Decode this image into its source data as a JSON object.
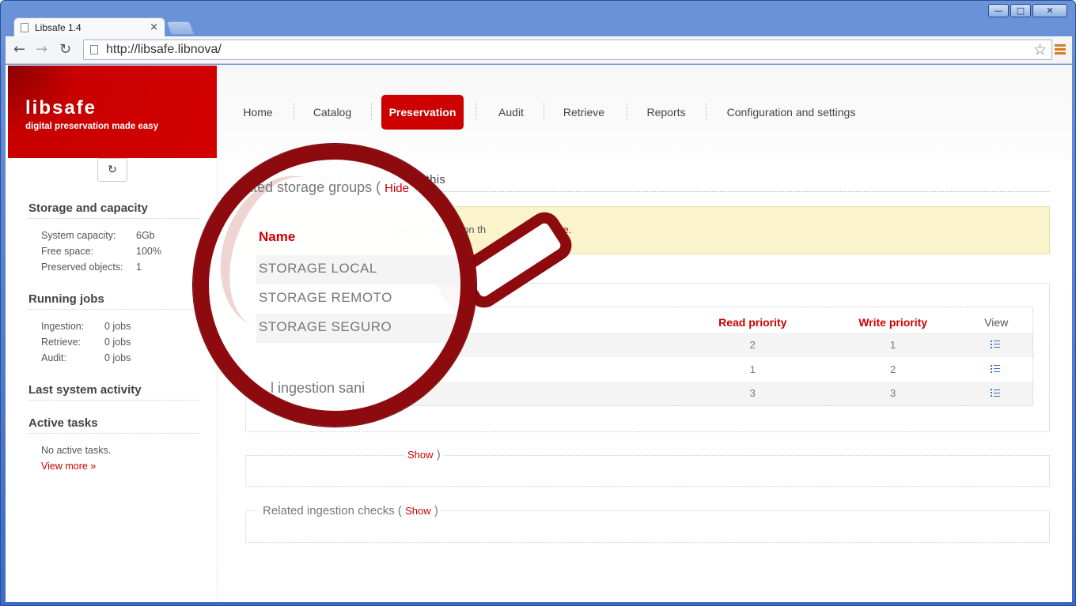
{
  "browser": {
    "tab_title": "Libsafe 1.4",
    "tab_close": "×",
    "url": "http://libsafe.libnova/",
    "window_buttons": [
      "▭",
      "◻",
      "✕"
    ]
  },
  "brand": {
    "name": "libsafe",
    "tagline": "digital preservation made easy"
  },
  "nav": [
    {
      "label": "Home"
    },
    {
      "label": "Catalog"
    },
    {
      "label": "Preservation",
      "active": true
    },
    {
      "label": "Audit"
    },
    {
      "label": "Retrieve"
    },
    {
      "label": "Reports"
    },
    {
      "label": "Configuration and settings"
    }
  ],
  "sidebar": {
    "storage_title": "Storage and capacity",
    "storage": [
      {
        "label": "System capacity:",
        "value": "6Gb"
      },
      {
        "label": "Free space:",
        "value": "100%"
      },
      {
        "label": "Preserved objects:",
        "value": "1"
      }
    ],
    "jobs_title": "Running jobs",
    "jobs": [
      {
        "label": "Ingestion:",
        "value": "0 jobs"
      },
      {
        "label": "Retrieve:",
        "value": "0 jobs"
      },
      {
        "label": "Audit:",
        "value": "0 jobs"
      }
    ],
    "activity_title": "Last system activity",
    "tasks_title": "Active tasks",
    "no_tasks": "No active tasks.",
    "view_more": "View more »"
  },
  "main": {
    "title": "New preservation plan based on this",
    "notice_prefix": "F",
    "notice_mid": "ion plan based on th",
    "notice_link": "ck here.",
    "storage_groups_legend": "elated storage groups (",
    "storage_groups_toggle": "Hide",
    "table": {
      "headers": [
        "Name",
        "Read priority",
        "Write priority",
        "View"
      ],
      "rows": [
        {
          "name": "STORAGE LOCAL",
          "read": "2",
          "write": "1"
        },
        {
          "name": "STORAGE REMOTO",
          "read": "1",
          "write": "2"
        },
        {
          "name": "STORAGE SEGURO",
          "read": "3",
          "write": "3"
        }
      ]
    },
    "sanitizers_legend": "l ingestion sani",
    "sanitizers_toggle": "Show",
    "checks_legend": "Related ingestion checks (",
    "checks_toggle": "Show",
    "paren_close": ")"
  },
  "colors": {
    "brand_red": "#cc0000",
    "magnifier": "#8d0a0e",
    "notice_bg": "#faf3cc"
  }
}
